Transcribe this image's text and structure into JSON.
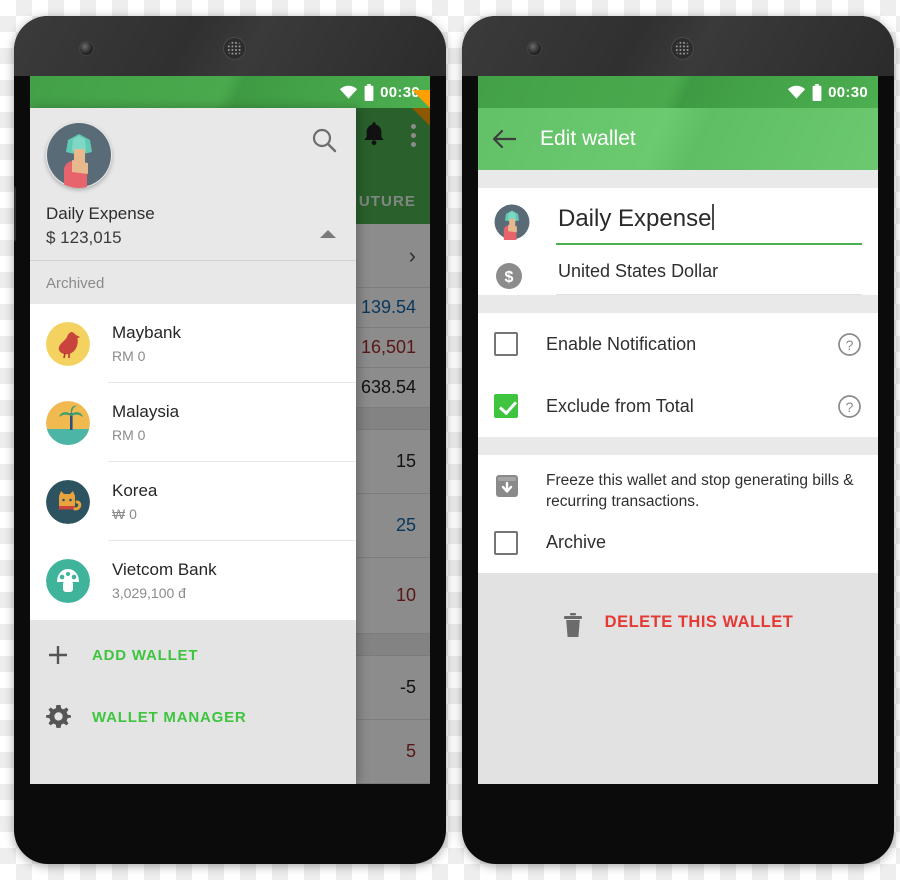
{
  "status_bar": {
    "time": "00:30",
    "wifi_icon": "wifi-icon",
    "battery_icon": "battery-icon"
  },
  "colors": {
    "status_green": "#43a047",
    "appbar_green": "#66c466",
    "accent_green": "#3ec43e",
    "delete_red": "#e53935",
    "flag_orange": "#ffa000"
  },
  "left_phone": {
    "background_app": {
      "tab_label": "UTURE",
      "bell_icon": "notification-bell-icon",
      "overflow_icon": "overflow-menu-icon",
      "chevron_icon": "chevron-right-icon",
      "rows": [
        {
          "value": "139.54",
          "tone": "blue"
        },
        {
          "value": "16,501",
          "tone": "red"
        },
        {
          "value": "638.54",
          "tone": "dark"
        },
        {
          "value": "15",
          "tone": "dark"
        },
        {
          "value": "25",
          "tone": "blue"
        },
        {
          "value": "10",
          "tone": "red"
        },
        {
          "value": "-5",
          "tone": "dark"
        },
        {
          "value": "5",
          "tone": "red"
        }
      ]
    },
    "drawer": {
      "search_icon": "search-icon",
      "collapse_icon": "caret-up-icon",
      "avatar_icon": "money-hand-avatar-icon",
      "current_wallet": {
        "name": "Daily Expense",
        "balance": "$ 123,015"
      },
      "section_label": "Archived",
      "wallets": [
        {
          "name": "Maybank",
          "balance": "RM 0",
          "avatar_icon": "bird-avatar-icon"
        },
        {
          "name": "Malaysia",
          "balance": "RM 0",
          "avatar_icon": "palm-beach-avatar-icon"
        },
        {
          "name": "Korea",
          "balance": "₩ 0",
          "avatar_icon": "cat-avatar-icon"
        },
        {
          "name": "Vietcom Bank",
          "balance": "3,029,100 đ",
          "avatar_icon": "mushroom-avatar-icon"
        }
      ],
      "actions": [
        {
          "label": "ADD WALLET",
          "icon": "plus-icon"
        },
        {
          "label": "WALLET MANAGER",
          "icon": "gear-icon"
        }
      ]
    }
  },
  "right_phone": {
    "appbar": {
      "back_icon": "back-arrow-icon",
      "title": "Edit wallet"
    },
    "name_field": {
      "value": "Daily Expense",
      "avatar_icon": "money-hand-avatar-icon"
    },
    "currency_field": {
      "value": "United States Dollar",
      "icon": "dollar-coin-icon"
    },
    "checkboxes": [
      {
        "label": "Enable Notification",
        "checked": false,
        "help_icon": "help-circle-icon"
      },
      {
        "label": "Exclude from Total",
        "checked": true,
        "help_icon": "help-circle-icon"
      }
    ],
    "freeze": {
      "icon": "archive-box-icon",
      "description": "Freeze this wallet and stop generating bills & recurring transactions.",
      "archive_label": "Archive",
      "archive_checked": false
    },
    "delete": {
      "label": "DELETE THIS WALLET",
      "icon": "trash-icon"
    }
  }
}
